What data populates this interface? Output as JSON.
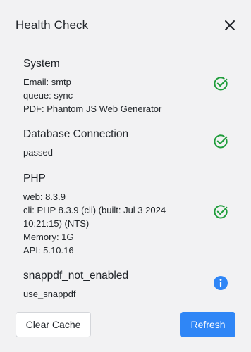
{
  "dialog": {
    "title": "Health Check",
    "close_icon": "close-icon"
  },
  "sections": [
    {
      "title": "System",
      "lines": [
        "Email: smtp",
        "queue: sync",
        "PDF: Phantom JS Web Generator"
      ],
      "status_icon": "check-circle-icon",
      "status_color": "#1f9d3a"
    },
    {
      "title": "Database Connection",
      "lines": [
        "passed"
      ],
      "status_icon": "check-circle-icon",
      "status_color": "#1f9d3a"
    },
    {
      "title": "PHP",
      "lines": [
        "web: 8.3.9",
        "cli: PHP 8.3.9 (cli) (built: Jul 3 2024 10:21:15) (NTS)",
        "Memory: 1G",
        "API: 5.10.16"
      ],
      "status_icon": "check-circle-icon",
      "status_color": "#1f9d3a"
    },
    {
      "title": "snappdf_not_enabled",
      "lines": [
        "use_snappdf"
      ],
      "status_icon": "info-circle-icon",
      "status_color": "#2f86f6"
    }
  ],
  "footer": {
    "clear_cache_label": "Clear Cache",
    "refresh_label": "Refresh"
  }
}
